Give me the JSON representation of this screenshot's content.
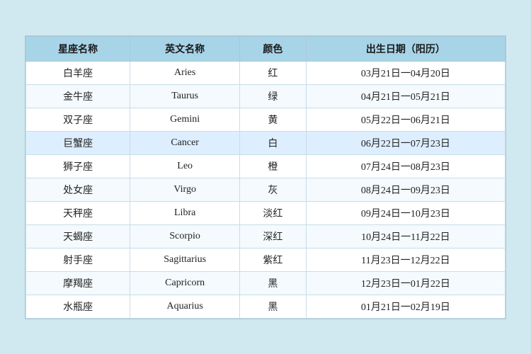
{
  "table": {
    "headers": [
      "星座名称",
      "英文名称",
      "颜色",
      "出生日期（阳历）"
    ],
    "rows": [
      {
        "chinese": "白羊座",
        "english": "Aries",
        "color": "红",
        "dates": "03月21日一04月20日",
        "highlight": false
      },
      {
        "chinese": "金牛座",
        "english": "Taurus",
        "color": "绿",
        "dates": "04月21日一05月21日",
        "highlight": false
      },
      {
        "chinese": "双子座",
        "english": "Gemini",
        "color": "黄",
        "dates": "05月22日一06月21日",
        "highlight": false
      },
      {
        "chinese": "巨蟹座",
        "english": "Cancer",
        "color": "白",
        "dates": "06月22日一07月23日",
        "highlight": true
      },
      {
        "chinese": "狮子座",
        "english": "Leo",
        "color": "橙",
        "dates": "07月24日一08月23日",
        "highlight": false
      },
      {
        "chinese": "处女座",
        "english": "Virgo",
        "color": "灰",
        "dates": "08月24日一09月23日",
        "highlight": false
      },
      {
        "chinese": "天秤座",
        "english": "Libra",
        "color": "淡红",
        "dates": "09月24日一10月23日",
        "highlight": false
      },
      {
        "chinese": "天蝎座",
        "english": "Scorpio",
        "color": "深红",
        "dates": "10月24日一11月22日",
        "highlight": false
      },
      {
        "chinese": "射手座",
        "english": "Sagittarius",
        "color": "紫红",
        "dates": "11月23日一12月22日",
        "highlight": false
      },
      {
        "chinese": "摩羯座",
        "english": "Capricorn",
        "color": "黑",
        "dates": "12月23日一01月22日",
        "highlight": false
      },
      {
        "chinese": "水瓶座",
        "english": "Aquarius",
        "color": "黑",
        "dates": "01月21日一02月19日",
        "highlight": false
      }
    ]
  }
}
